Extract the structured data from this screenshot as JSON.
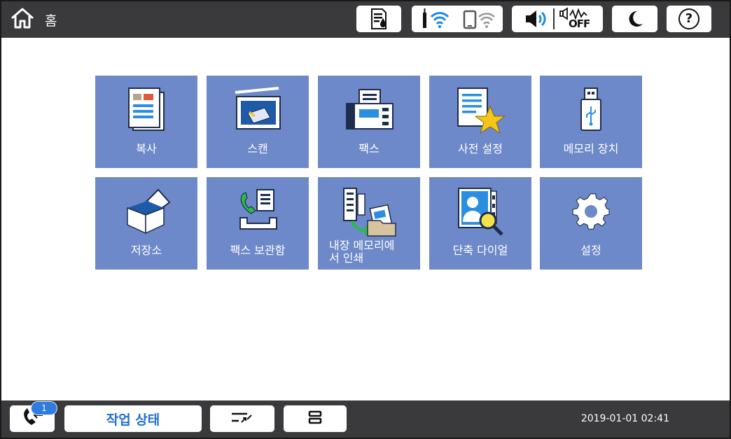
{
  "topbar": {
    "home_label": "홈",
    "icons": {
      "home": "home-icon",
      "maintenance": "ink-supply-icon",
      "wifi": "wifi-icon",
      "wifi_direct": "wifi-direct-icon",
      "sound": "speaker-icon",
      "quiet": "quiet-mode-off-icon",
      "sleep": "sleep-moon-icon",
      "help": "help-icon"
    },
    "quiet_off_text": "OFF",
    "help_text": "?"
  },
  "tiles": [
    {
      "label": "복사",
      "icon": "copy-icon"
    },
    {
      "label": "스캔",
      "icon": "scan-icon"
    },
    {
      "label": "팩스",
      "icon": "fax-icon"
    },
    {
      "label": "사전 설정",
      "icon": "presets-icon"
    },
    {
      "label": "메모리 장치",
      "icon": "usb-memory-icon"
    },
    {
      "label": "저장소",
      "icon": "storage-icon"
    },
    {
      "label": "팩스 보관함",
      "icon": "fax-box-icon"
    },
    {
      "label_line1": "내장 메모리에",
      "label_line2": "서 인쇄",
      "icon": "print-from-memory-icon"
    },
    {
      "label": "단축 다이얼",
      "icon": "speed-dial-icon"
    },
    {
      "label": "설정",
      "icon": "settings-gear-icon"
    }
  ],
  "bottombar": {
    "fax_badge": "1",
    "job_status_label": "작업 상태",
    "datetime": "2019-01-01 02:41"
  },
  "colors": {
    "tile_bg": "#6e89c9",
    "bar_bg": "#3a3a3c",
    "accent_blue": "#2f7be0",
    "star_yellow": "#f5c518"
  }
}
